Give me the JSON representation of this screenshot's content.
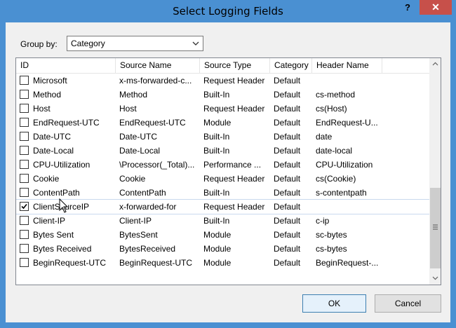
{
  "window": {
    "title": "Select Logging Fields",
    "help_label": "?",
    "close_label": "✕"
  },
  "group_by": {
    "label": "Group by:",
    "value": "Category"
  },
  "table": {
    "columns": [
      "ID",
      "Source Name",
      "Source Type",
      "Category",
      "Header Name"
    ],
    "rows": [
      {
        "checked": false,
        "id": "Microsoft",
        "source_name": "x-ms-forwarded-c...",
        "source_type": "Request Header",
        "category": "Default",
        "header_name": ""
      },
      {
        "checked": false,
        "id": "Method",
        "source_name": "Method",
        "source_type": "Built-In",
        "category": "Default",
        "header_name": "cs-method"
      },
      {
        "checked": false,
        "id": "Host",
        "source_name": "Host",
        "source_type": "Request Header",
        "category": "Default",
        "header_name": "cs(Host)"
      },
      {
        "checked": false,
        "id": "EndRequest-UTC",
        "source_name": "EndRequest-UTC",
        "source_type": "Module",
        "category": "Default",
        "header_name": "EndRequest-U..."
      },
      {
        "checked": false,
        "id": "Date-UTC",
        "source_name": "Date-UTC",
        "source_type": "Built-In",
        "category": "Default",
        "header_name": "date"
      },
      {
        "checked": false,
        "id": "Date-Local",
        "source_name": "Date-Local",
        "source_type": "Built-In",
        "category": "Default",
        "header_name": "date-local"
      },
      {
        "checked": false,
        "id": "CPU-Utilization",
        "source_name": "\\Processor(_Total)...",
        "source_type": "Performance ...",
        "category": "Default",
        "header_name": "CPU-Utilization"
      },
      {
        "checked": false,
        "id": "Cookie",
        "source_name": "Cookie",
        "source_type": "Request Header",
        "category": "Default",
        "header_name": "cs(Cookie)"
      },
      {
        "checked": false,
        "id": "ContentPath",
        "source_name": "ContentPath",
        "source_type": "Built-In",
        "category": "Default",
        "header_name": "s-contentpath"
      },
      {
        "checked": true,
        "id": "ClientSourceIP",
        "source_name": "x-forwarded-for",
        "source_type": "Request Header",
        "category": "Default",
        "header_name": ""
      },
      {
        "checked": false,
        "id": "Client-IP",
        "source_name": "Client-IP",
        "source_type": "Built-In",
        "category": "Default",
        "header_name": "c-ip"
      },
      {
        "checked": false,
        "id": "Bytes Sent",
        "source_name": "BytesSent",
        "source_type": "Module",
        "category": "Default",
        "header_name": "sc-bytes"
      },
      {
        "checked": false,
        "id": "Bytes Received",
        "source_name": "BytesReceived",
        "source_type": "Module",
        "category": "Default",
        "header_name": "cs-bytes"
      },
      {
        "checked": false,
        "id": "BeginRequest-UTC",
        "source_name": "BeginRequest-UTC",
        "source_type": "Module",
        "category": "Default",
        "header_name": "BeginRequest-..."
      }
    ]
  },
  "buttons": {
    "ok": "OK",
    "cancel": "Cancel"
  },
  "icons": {
    "scroll_up": "chevron-up-icon",
    "scroll_down": "chevron-down-icon",
    "dropdown": "chevron-down-icon",
    "check": "check-icon",
    "cursor": "mouse-pointer-icon"
  }
}
